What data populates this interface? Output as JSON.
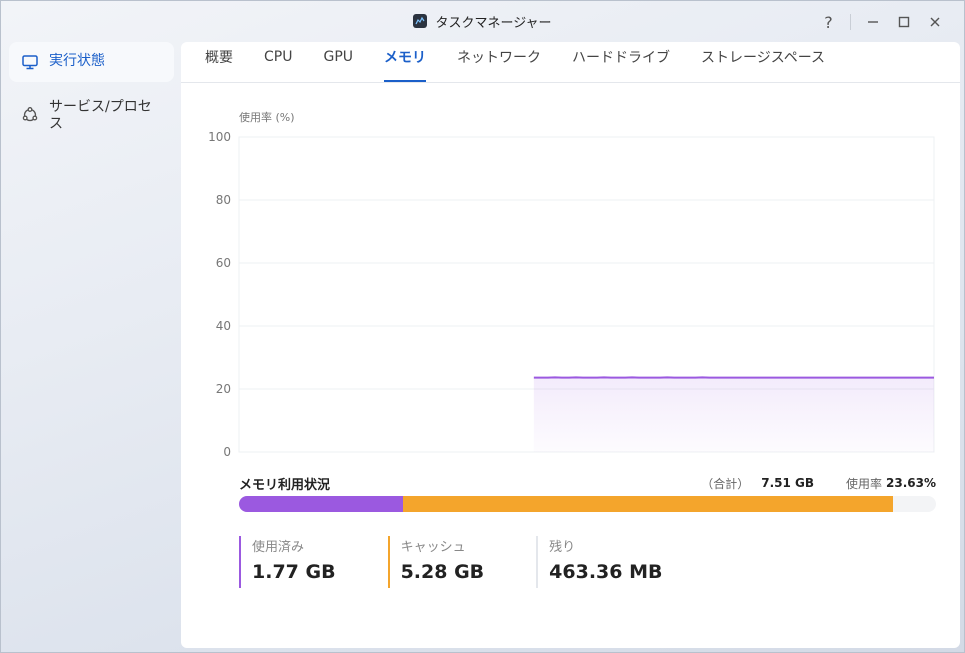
{
  "window": {
    "title": "タスクマネージャー",
    "help": "?",
    "minimize": "—",
    "maximize": "☐",
    "close": "✕"
  },
  "sidebar": {
    "items": [
      {
        "label": "実行状態",
        "active": true,
        "icon": "monitor-icon"
      },
      {
        "label": "サービス/プロセス",
        "active": false,
        "icon": "services-icon"
      }
    ]
  },
  "tabs": [
    {
      "label": "概要"
    },
    {
      "label": "CPU"
    },
    {
      "label": "GPU"
    },
    {
      "label": "メモリ",
      "active": true
    },
    {
      "label": "ネットワーク"
    },
    {
      "label": "ハードドライブ"
    },
    {
      "label": "ストレージスペース"
    }
  ],
  "chart_data": {
    "type": "area",
    "ylabel": "使用率 (%)",
    "ylim": [
      0,
      100
    ],
    "yticks": [
      "100",
      "80",
      "60",
      "40",
      "20",
      "0"
    ],
    "grid": true,
    "series": [
      {
        "values": [
          null,
          null,
          null,
          null,
          null,
          null,
          null,
          null,
          null,
          null,
          null,
          null,
          null,
          null,
          null,
          null,
          null,
          null,
          null,
          null,
          null,
          null,
          null,
          null,
          null,
          null,
          null,
          null,
          null,
          null,
          null,
          null,
          null,
          null,
          null,
          null,
          null,
          null,
          null,
          null,
          null,
          null,
          23.6,
          23.6,
          23.6,
          23.7,
          23.6,
          23.6,
          23.7,
          23.6,
          23.6,
          23.6,
          23.7,
          23.6,
          23.6,
          23.6,
          23.7,
          23.6,
          23.6,
          23.6,
          23.6,
          23.7,
          23.6,
          23.6,
          23.6,
          23.6,
          23.7,
          23.6,
          23.6,
          23.6,
          23.6,
          23.6,
          23.6,
          23.6,
          23.6,
          23.6,
          23.6,
          23.6,
          23.6,
          23.6,
          23.6,
          23.6,
          23.6,
          23.6,
          23.6,
          23.6,
          23.6,
          23.6,
          23.6,
          23.6,
          23.6,
          23.6,
          23.6,
          23.6,
          23.6,
          23.6,
          23.6,
          23.6,
          23.6,
          23.6
        ]
      }
    ],
    "line_color": "#9b59e0"
  },
  "memory": {
    "title": "メモリ利用状況",
    "total_label": "（合計）",
    "total": "7.51 GB",
    "rate_label": "使用率",
    "rate": "23.63%",
    "used_fraction": 0.2357,
    "cache_fraction": 0.7031,
    "stats": [
      {
        "label": "使用済み",
        "value": "1.77 GB",
        "color": "#9b59e0"
      },
      {
        "label": "キャッシュ",
        "value": "5.28 GB",
        "color": "#f4a52c"
      },
      {
        "label": "残り",
        "value": "463.36 MB"
      }
    ]
  }
}
